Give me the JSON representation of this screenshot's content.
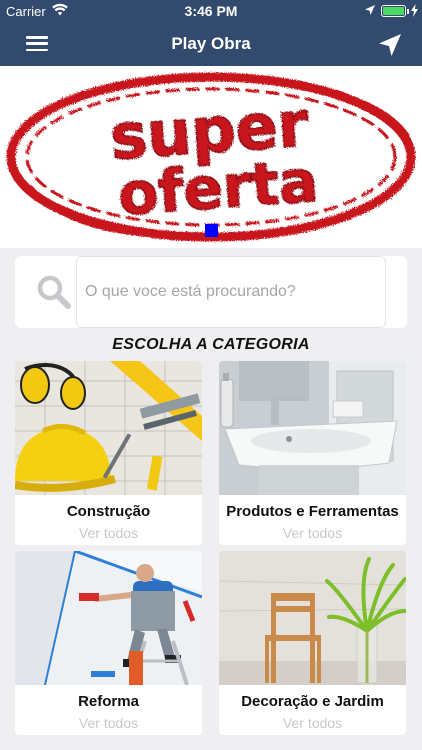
{
  "status_bar": {
    "carrier": "Carrier",
    "time": "3:46 PM",
    "icons": [
      "wifi-icon",
      "location-arrow-icon",
      "battery-icon",
      "charging-bolt-icon"
    ]
  },
  "nav": {
    "title": "Play Obra",
    "left_icon": "hamburger-menu-icon",
    "right_icon": "navigation-arrow-icon"
  },
  "banner": {
    "stamp_line1": "super",
    "stamp_line2": "oferta",
    "stamp_color": "#c8141e"
  },
  "search": {
    "placeholder": "O que voce está procurando?",
    "value": "",
    "icon": "search-icon"
  },
  "section_title": "ESCOLHA A CATEGORIA",
  "categories": [
    {
      "name": "Construção",
      "sub": "Ver todos",
      "image": "construction-tools-photo"
    },
    {
      "name": "Produtos e Ferramentas",
      "sub": "Ver todos",
      "image": "bathroom-sink-photo"
    },
    {
      "name": "Reforma",
      "sub": "Ver todos",
      "image": "painter-ladder-photo"
    },
    {
      "name": "Decoração e Jardim",
      "sub": "Ver todos",
      "image": "chair-plant-photo"
    }
  ],
  "colors": {
    "nav_background": "#314a6d",
    "page_background": "#efeff1",
    "pager_dot": "#0000ff",
    "sub_text": "#c8c8cc"
  }
}
